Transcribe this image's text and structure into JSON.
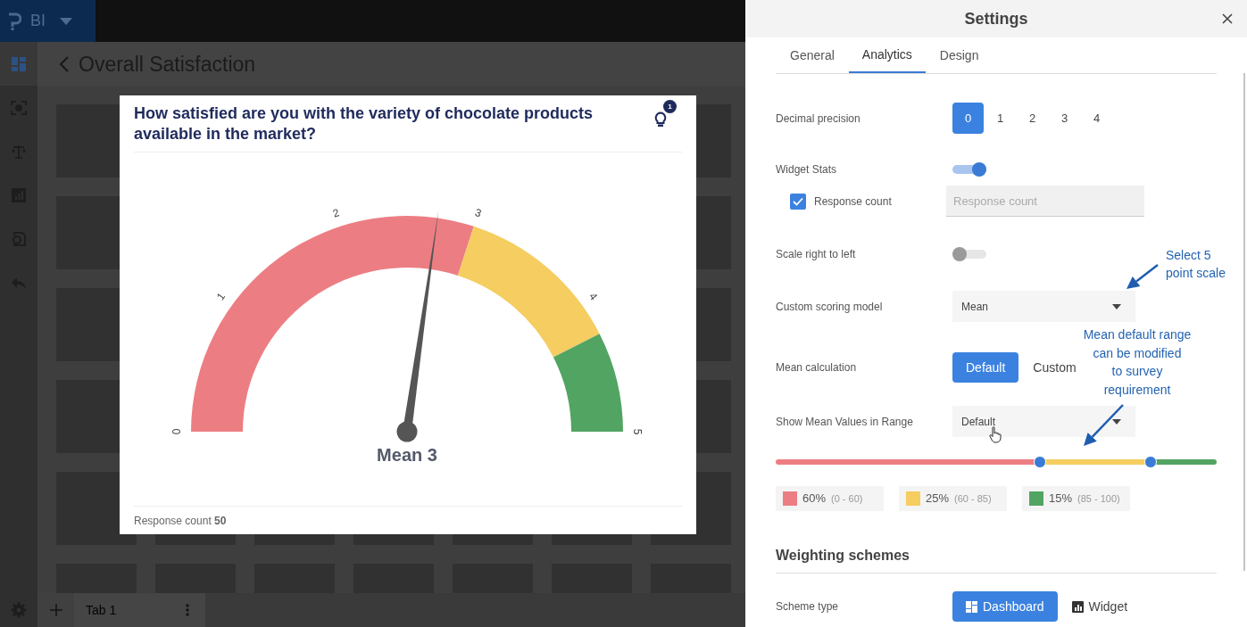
{
  "app": {
    "name": "BI"
  },
  "sidebar": {
    "items": [
      {
        "kind": "dashboard",
        "selected": true
      },
      {
        "kind": "scan",
        "selected": false
      },
      {
        "kind": "scale",
        "selected": false
      },
      {
        "kind": "chart",
        "selected": false
      },
      {
        "kind": "export",
        "selected": false
      },
      {
        "kind": "undo",
        "selected": false
      }
    ]
  },
  "page": {
    "title": "Overall Satisfaction"
  },
  "bottom_bar": {
    "tabs": [
      {
        "label": "Tab 1"
      }
    ]
  },
  "widget": {
    "title": "How satisfied are you with the variety of chocolate products available in the market?",
    "insights_badge": "1",
    "gauge": {
      "ticks": [
        "0",
        "1",
        "2",
        "3",
        "4",
        "5"
      ],
      "segments": [
        {
          "color": "#ec7e83"
        },
        {
          "color": "#f5cd60"
        },
        {
          "color": "#52a463"
        }
      ],
      "needle": {
        "level": 0.545
      },
      "value_label": "Mean 3"
    },
    "footer": "Response count **50**"
  },
  "settings": {
    "title": "Settings",
    "tabs": [
      {
        "label": "General",
        "selected": false
      },
      {
        "label": "Analytics",
        "selected": true
      },
      {
        "label": "Design",
        "selected": false
      }
    ],
    "rows": [
      {
        "kind": "segmented",
        "label": "Decimal precision",
        "options": [
          {
            "label": "0",
            "selected": true
          },
          {
            "label": "1",
            "selected": false
          },
          {
            "label": "2",
            "selected": false
          },
          {
            "label": "3",
            "selected": false
          },
          {
            "label": "4",
            "selected": false
          }
        ]
      },
      {
        "kind": "toggle",
        "label": "Widget Stats",
        "on": true
      },
      {
        "kind": "checkbox",
        "label": "Response count",
        "checked": true,
        "placeholder": "Response count"
      },
      {
        "kind": "toggle",
        "label": "Scale right to left",
        "on": false
      },
      {
        "kind": "select",
        "label": "Custom scoring model",
        "value": "Mean"
      },
      {
        "kind": "segmented",
        "label": "Mean calculation",
        "options": [
          {
            "label": "Default",
            "selected": true
          },
          {
            "label": "Custom",
            "selected": false
          }
        ]
      },
      {
        "kind": "select",
        "label": "Show Mean Values in Range",
        "value": "Default"
      },
      {
        "kind": "range",
        "thumbs": [
          {
            "level": 0.6
          },
          {
            "level": 0.85
          }
        ],
        "legend": [
          {
            "color": "#ec7e83",
            "share": "60%",
            "range": "(0 - 60)"
          },
          {
            "color": "#f5cd60",
            "share": "25%",
            "range": "(60 - 85)"
          },
          {
            "color": "#52a463",
            "share": "15%",
            "range": "(85 - 100)"
          }
        ]
      },
      {
        "kind": "heading",
        "label": "Weighting schemes"
      },
      {
        "kind": "scheme",
        "label": "Scheme type",
        "options": [
          {
            "label": "Dashboard",
            "selected": true
          },
          {
            "label": "Widget",
            "selected": false
          }
        ]
      }
    ]
  },
  "annotations": [
    {
      "lines": [
        "Select 5",
        "point scale"
      ]
    },
    {
      "lines": [
        "Mean default range",
        "can be modified",
        "to survey",
        "requirement"
      ]
    }
  ]
}
